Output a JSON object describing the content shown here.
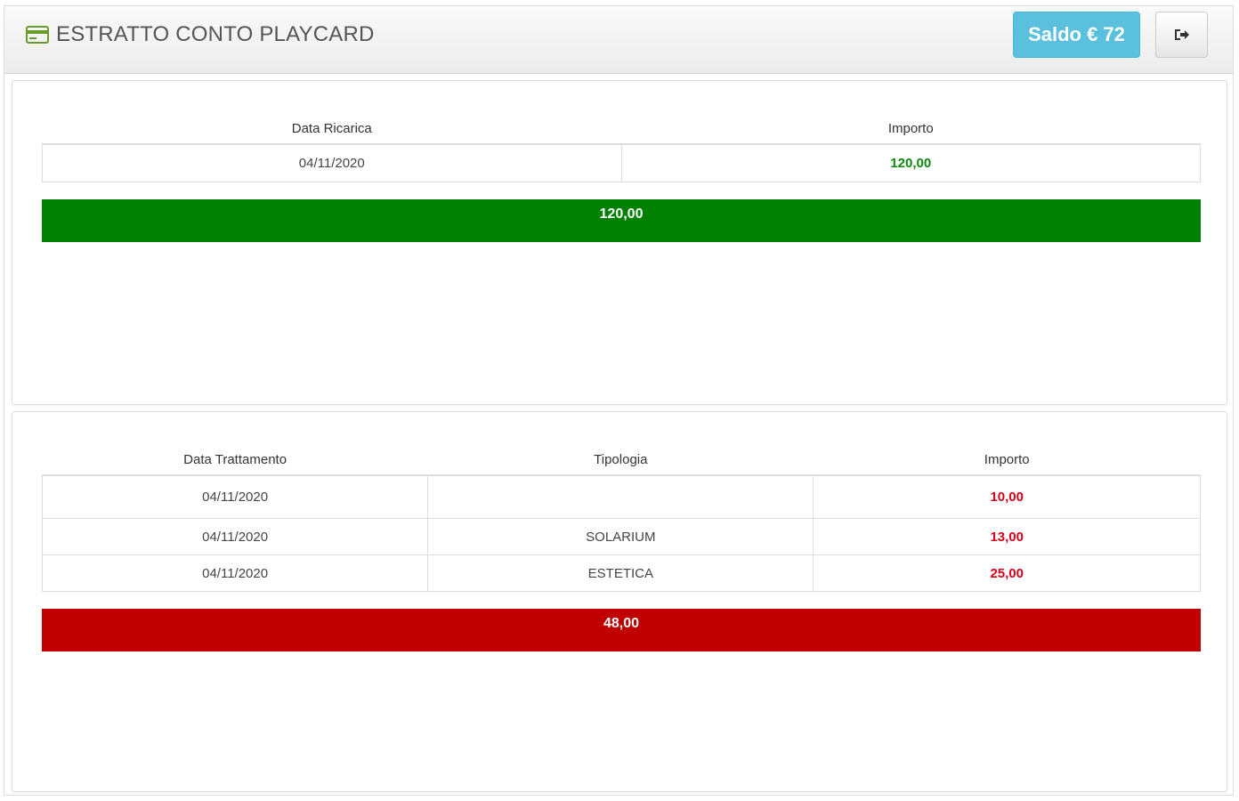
{
  "header": {
    "title": "ESTRATTO CONTO PLAYCARD",
    "icon": "credit-card-icon",
    "saldo_label": "Saldo € 72",
    "logout_icon": "sign-out-icon"
  },
  "colors": {
    "saldo_button": "#5bc0de",
    "positive_amount": "#0a8a0a",
    "negative_amount": "#d9001b",
    "total_positive": "#008000",
    "total_negative": "#c00000"
  },
  "ricariche": {
    "columns": [
      "Data Ricarica",
      "Importo"
    ],
    "rows": [
      {
        "data": "04/11/2020",
        "importo": "120,00"
      }
    ],
    "total": "120,00"
  },
  "trattamenti": {
    "columns": [
      "Data Trattamento",
      "Tipologia",
      "Importo"
    ],
    "rows": [
      {
        "data": "04/11/2020",
        "tipologia": "",
        "importo": "10,00"
      },
      {
        "data": "04/11/2020",
        "tipologia": "SOLARIUM",
        "importo": "13,00"
      },
      {
        "data": "04/11/2020",
        "tipologia": "ESTETICA",
        "importo": "25,00"
      }
    ],
    "total": "48,00"
  }
}
